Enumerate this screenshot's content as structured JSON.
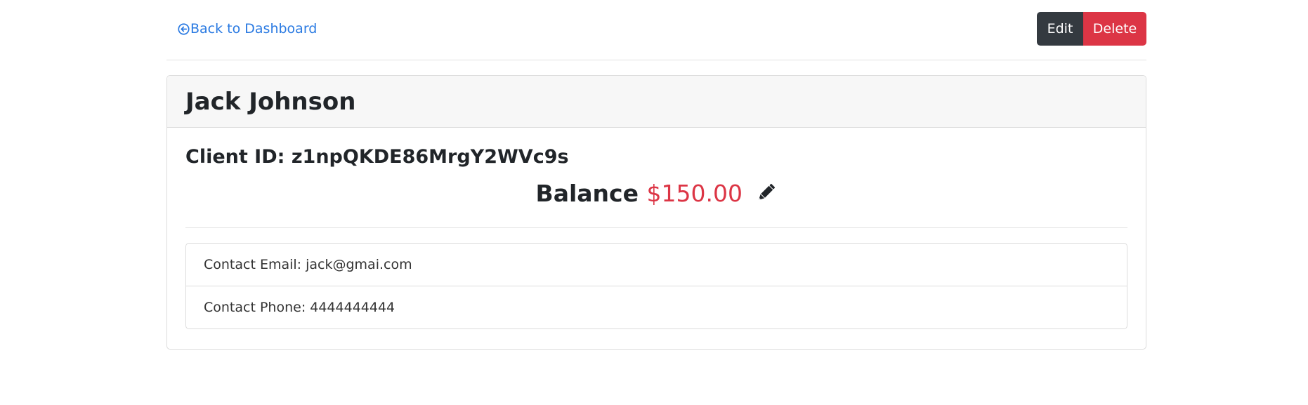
{
  "nav": {
    "back_label": "Back to Dashboard"
  },
  "actions": {
    "edit_label": "Edit",
    "delete_label": "Delete"
  },
  "client": {
    "name": "Jack Johnson",
    "id_text": "Client ID: z1npQKDE86MrgY2WVc9s",
    "balance_label": "Balance",
    "balance_amount": "$150.00",
    "contact_email": "Contact Email: jack@gmai.com",
    "contact_phone": "Contact Phone: 4444444444"
  },
  "icons": {
    "back": "arrow-circle-left-icon",
    "edit_balance": "pencil-icon"
  },
  "colors": {
    "link": "#2a7ae2",
    "edit_button": "#343a40",
    "delete_button": "#dc3545",
    "balance_amount": "#dc3545",
    "card_header_bg": "#f7f7f7"
  }
}
